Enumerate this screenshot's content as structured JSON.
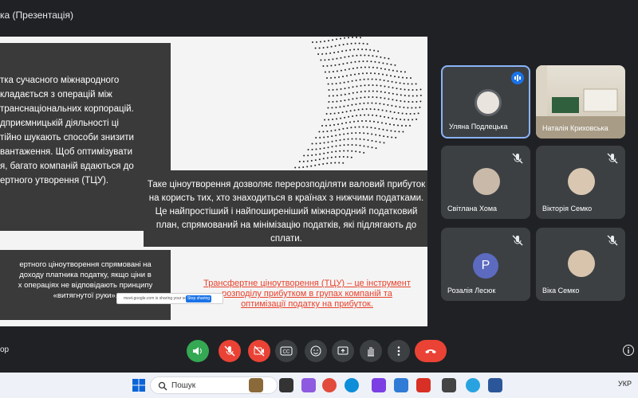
{
  "window": {
    "title": "ка (Презентація)"
  },
  "slide": {
    "paragraph_top": "тка сучасного міжнародного\nкладається з операцій між\nтранснаціональних корпорацій.\nдприємницькій діяльності ці\nтійно шукають способи знизити\nвантаження. Щоб оптимізувати\nя, багато компаній вдаються до\nертного утворення (ТЦУ).",
    "paragraph_middle": "Таке ціноутворення дозволяє перерозподіляти валовий прибуток на користь тих, хто знаходиться в країнах з нижчими податками. Це найпростіший і найпоширеніший міжнародний податковий план, спрямований на мінімізацію податків, які підлягають до сплати.",
    "paragraph_bottom": "ертного ціноутворення спрямовані на\nдоходу платника податку, якщо ціни в\nх операціях не відповідають принципу\n«витягнутої руки».",
    "red_text": "Трансфертне ціноутворення (ТЦУ) – це інструмент розподілу прибутком в групах компаній та оптимізації податку на прибуток.",
    "share_notice": "meet.google.com is sharing your screen.",
    "stop_sharing": "Stop sharing"
  },
  "participants": [
    {
      "name": "Уляна Подлецька",
      "active": true,
      "speaking": true
    },
    {
      "name": "Наталія Криховська",
      "active": false,
      "speaking": false
    },
    {
      "name": "Світлана Хома",
      "active": false,
      "speaking": false
    },
    {
      "name": "Вікторія Семко",
      "active": false,
      "speaking": false
    },
    {
      "name": "Розалія Лесюк",
      "active": false,
      "speaking": false,
      "initial": "P"
    },
    {
      "name": "Віка Семко",
      "active": false,
      "speaking": false
    }
  ],
  "controls": {
    "left_label": "ор",
    "buttons": [
      "speaker-icon",
      "mic-off-icon",
      "camera-off-icon",
      "captions-icon",
      "emoji-icon",
      "present-icon",
      "hand-icon",
      "more-icon",
      "end-call-icon"
    ]
  },
  "taskbar": {
    "search_label": "Пошук",
    "language": "УКР"
  },
  "colors": {
    "accent_blue": "#1a73e8",
    "end_call_red": "#ea4335",
    "green": "#34a853",
    "slide_red_text": "#e8412c"
  }
}
